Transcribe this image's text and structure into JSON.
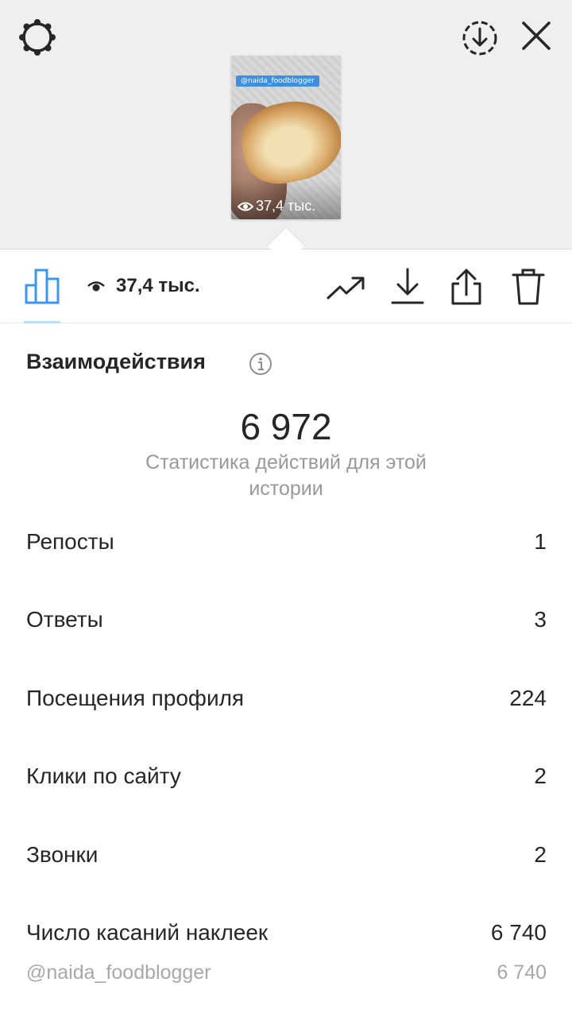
{
  "story": {
    "sticker_tag": "@naida_foodblogger",
    "views": "37,4 тыс."
  },
  "toolbar": {
    "views_count": "37,4 тыс."
  },
  "icons": {
    "settings": "gear-icon",
    "download": "download-circle-icon",
    "close": "close-icon",
    "stats": "bar-chart-icon",
    "views": "eye-icon",
    "promote": "trend-up-icon",
    "save": "download-icon",
    "share": "share-icon",
    "delete": "trash-icon",
    "info": "info-icon"
  },
  "colors": {
    "accent": "#3897f0",
    "tag_blue": "#3f8fe0",
    "muted_text": "#999999",
    "text": "#262626"
  },
  "interactions": {
    "title": "Взаимодействия",
    "total": "6 972",
    "subtitle": "Статистика действий для этой истории",
    "rows": [
      {
        "label": "Репосты",
        "value": "1"
      },
      {
        "label": "Ответы",
        "value": "3"
      },
      {
        "label": "Посещения профиля",
        "value": "224"
      },
      {
        "label": "Клики по сайту",
        "value": "2"
      },
      {
        "label": "Звонки",
        "value": "2"
      },
      {
        "label": "Число касаний наклеек",
        "value": "6 740"
      }
    ],
    "sticker_breakdown": {
      "label": "@naida_foodblogger",
      "value": "6 740"
    }
  }
}
